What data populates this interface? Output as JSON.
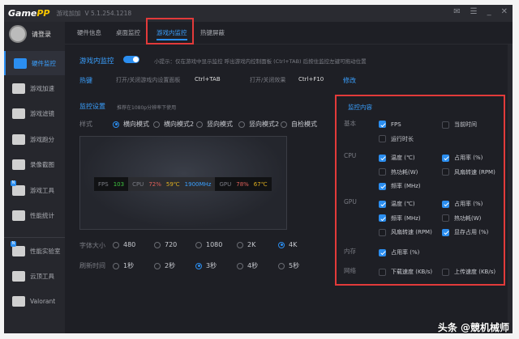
{
  "titlebar": {
    "logo_a": "Game",
    "logo_b": "PP",
    "app": "游戏加加",
    "version": "V 5.1.254.1218"
  },
  "user": {
    "login": "请登录"
  },
  "sidebar": {
    "items": [
      {
        "label": "硬件监控"
      },
      {
        "label": "游戏加速"
      },
      {
        "label": "游戏滤镜"
      },
      {
        "label": "游戏跑分"
      },
      {
        "label": "录像截图"
      },
      {
        "label": "游戏工具",
        "badge": "N"
      },
      {
        "label": "性能统计"
      },
      {
        "label": "性能实验室",
        "badge": "N"
      },
      {
        "label": "云顶工具"
      },
      {
        "label": "Valorant"
      }
    ]
  },
  "tabs": [
    {
      "label": "硬件信息"
    },
    {
      "label": "桌面监控"
    },
    {
      "label": "游戏内监控"
    },
    {
      "label": "热键屏蔽"
    }
  ],
  "main": {
    "title": "游戏内监控",
    "toggle_on": true,
    "hint": "小提示：仅在游戏中显示监控 呼出游戏内控制面板 (Ctrl+TAB) 后按住监控左键可拖动位置",
    "hotkey_label": "热键",
    "hk1_label": "打开/关闭游戏内设置面板",
    "hk1_value": "Ctrl+TAB",
    "hk2_label": "打开/关闭效果",
    "hk2_value": "Ctrl+F10",
    "modify": "修改",
    "settings_title": "监控设置",
    "settings_note": "推荐在1080p分辨率下使用",
    "style_label": "样式",
    "styles": [
      "横向模式",
      "横向模式2",
      "竖向模式",
      "竖向模式2",
      "自检模式"
    ],
    "style_selected": 0,
    "osd": {
      "fps_label": "FPS",
      "fps": "103",
      "cpu_label": "CPU",
      "cpu_use": "72%",
      "cpu_temp": "59℃",
      "cpu_freq": "1900MHz",
      "gpu_label": "GPU",
      "gpu_use": "78%",
      "gpu_temp": "67℃"
    },
    "font_label": "字体大小",
    "fonts": [
      "480",
      "720",
      "1080",
      "2K",
      "4K"
    ],
    "font_selected": 4,
    "refresh_label": "刷新时间",
    "refresh": [
      "1秒",
      "2秒",
      "3秒",
      "4秒",
      "5秒"
    ],
    "refresh_selected": 2
  },
  "content": {
    "title": "监控内容",
    "groups": [
      {
        "label": "基本",
        "items": [
          {
            "label": "FPS",
            "on": true
          },
          {
            "label": "当前时间",
            "on": false
          },
          {
            "label": "运行时长",
            "on": false
          }
        ]
      },
      {
        "label": "CPU",
        "items": [
          {
            "label": "温度 (℃)",
            "on": true
          },
          {
            "label": "占用率 (%)",
            "on": true
          },
          {
            "label": "热功耗(W)",
            "on": false
          },
          {
            "label": "风扇转速 (RPM)",
            "on": false
          },
          {
            "label": "频率 (MHz)",
            "on": true
          }
        ]
      },
      {
        "label": "GPU",
        "items": [
          {
            "label": "温度 (℃)",
            "on": true
          },
          {
            "label": "占用率 (%)",
            "on": true
          },
          {
            "label": "频率 (MHz)",
            "on": true
          },
          {
            "label": "热功耗(W)",
            "on": false
          },
          {
            "label": "风扇转速 (RPM)",
            "on": false
          },
          {
            "label": "显存占用 (%)",
            "on": true
          }
        ]
      },
      {
        "label": "内存",
        "items": [
          {
            "label": "占用率 (%)",
            "on": true
          }
        ]
      },
      {
        "label": "网络",
        "items": [
          {
            "label": "下载速度 (KB/s)",
            "on": false
          },
          {
            "label": "上传速度 (KB/s)",
            "on": false
          }
        ]
      }
    ]
  },
  "watermark": "头条 @競机械师",
  "colors": {
    "accent": "#2b8ef0",
    "highlight": "#e23a3a",
    "fps": "#3ec53e",
    "cpu_use": "#e0605a",
    "temp": "#e0b020",
    "freq": "#3aa0ff"
  }
}
